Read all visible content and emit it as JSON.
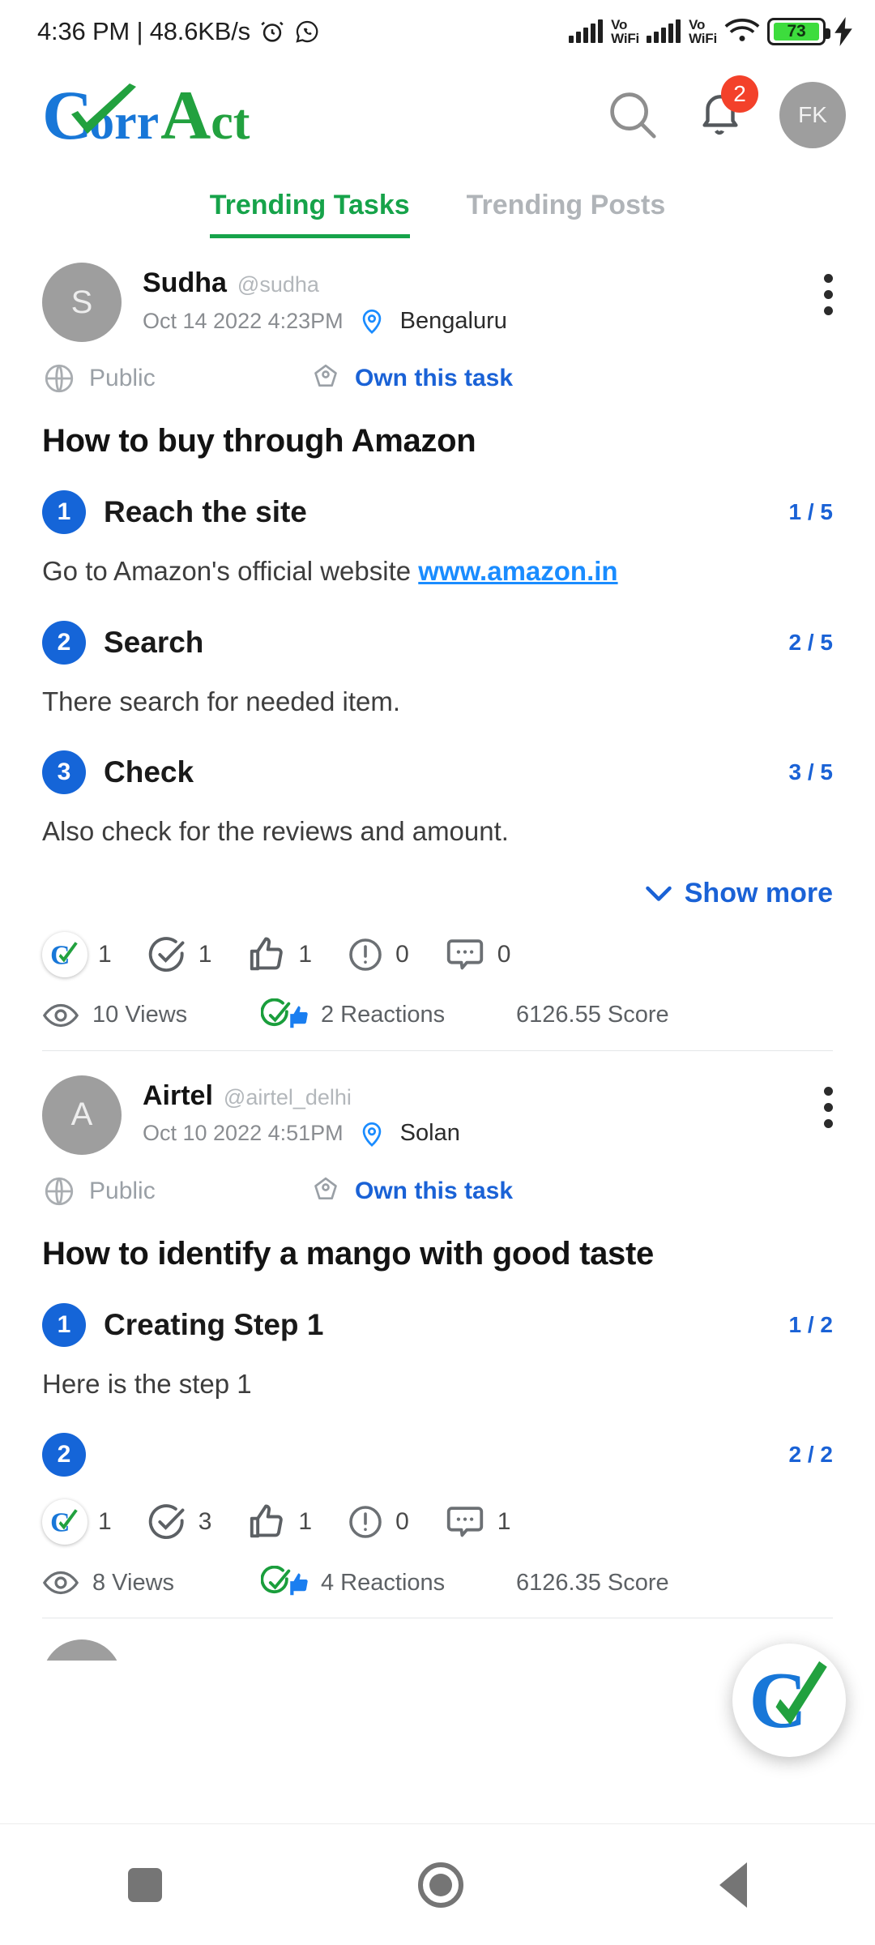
{
  "status_bar": {
    "time_and_speed": "4:36 PM | 48.6KB/s",
    "alarm_icon": "alarm-icon",
    "whatsapp_icon": "whatsapp-icon",
    "signal_1_label": "VoWiFi",
    "signal_2_label": "VoWiFi",
    "vo": "Vo",
    "wifi_text": "WiFi",
    "wifi_icon": "wifi-icon",
    "battery_level": "73",
    "charging_icon": "charging-bolt-icon"
  },
  "header": {
    "logo": {
      "c": "C",
      "orr": "orr",
      "a": "A",
      "ct": "ct",
      "full": "CorrAct"
    },
    "search_icon": "search-icon",
    "notifications_icon": "bell-icon",
    "notification_count": "2",
    "avatar_initials": "FK"
  },
  "tabs": [
    {
      "label": "Trending Tasks",
      "active": true
    },
    {
      "label": "Trending Posts",
      "active": false
    }
  ],
  "posts": [
    {
      "avatar_initial": "S",
      "name": "Sudha",
      "handle": "@sudha",
      "timestamp": "Oct 14 2022 4:23PM",
      "location": "Bengaluru",
      "visibility": "Public",
      "own_action": "Own this task",
      "title": "How to buy through Amazon",
      "steps": [
        {
          "num": "1",
          "title": "Reach the site",
          "count": "1 / 5",
          "body_pre": "Go to Amazon's official website ",
          "body_link": "www.amazon.in"
        },
        {
          "num": "2",
          "title": "Search",
          "count": "2 / 5",
          "body_pre": "There search for needed item.",
          "body_link": ""
        },
        {
          "num": "3",
          "title": "Check",
          "count": "3 / 5",
          "body_pre": "Also check for the reviews and amount.",
          "body_link": ""
        }
      ],
      "show_more": "Show more",
      "reactions": [
        {
          "icon": "corract-logo-icon",
          "count": "1"
        },
        {
          "icon": "check-circle-icon",
          "count": "1"
        },
        {
          "icon": "thumbs-up-icon",
          "count": "1"
        },
        {
          "icon": "exclamation-circle-icon",
          "count": "0"
        },
        {
          "icon": "comment-icon",
          "count": "0"
        }
      ],
      "views": "10 Views",
      "reaction_total": "2 Reactions",
      "score": "6126.55 Score"
    },
    {
      "avatar_initial": "A",
      "name": "Airtel",
      "handle": "@airtel_delhi",
      "timestamp": "Oct 10 2022 4:51PM",
      "location": "Solan",
      "visibility": "Public",
      "own_action": "Own this task",
      "title": "How to identify a mango with good taste",
      "steps": [
        {
          "num": "1",
          "title": "Creating Step 1",
          "count": "1 / 2",
          "body_pre": "Here is the step 1",
          "body_link": ""
        },
        {
          "num": "2",
          "title": "",
          "count": "2 / 2",
          "body_pre": "",
          "body_link": ""
        }
      ],
      "reactions": [
        {
          "icon": "corract-logo-icon",
          "count": "1"
        },
        {
          "icon": "check-circle-icon",
          "count": "3"
        },
        {
          "icon": "thumbs-up-icon",
          "count": "1"
        },
        {
          "icon": "exclamation-circle-icon",
          "count": "0"
        },
        {
          "icon": "comment-icon",
          "count": "1"
        }
      ],
      "views": "8 Views",
      "reaction_total": "4 Reactions",
      "score": "6126.35 Score"
    }
  ],
  "fab": {
    "icon": "corract-logo-icon"
  },
  "nav_bar": {
    "recents_icon": "square-recents-icon",
    "home_icon": "circle-home-icon",
    "back_icon": "triangle-back-icon"
  },
  "colors": {
    "brand_blue": "#1877d8",
    "brand_green": "#22a13f",
    "tab_active": "#16a34a",
    "link_blue": "#1a62d6",
    "badge_red": "#f3412a",
    "battery_green": "#3ddc3d"
  }
}
